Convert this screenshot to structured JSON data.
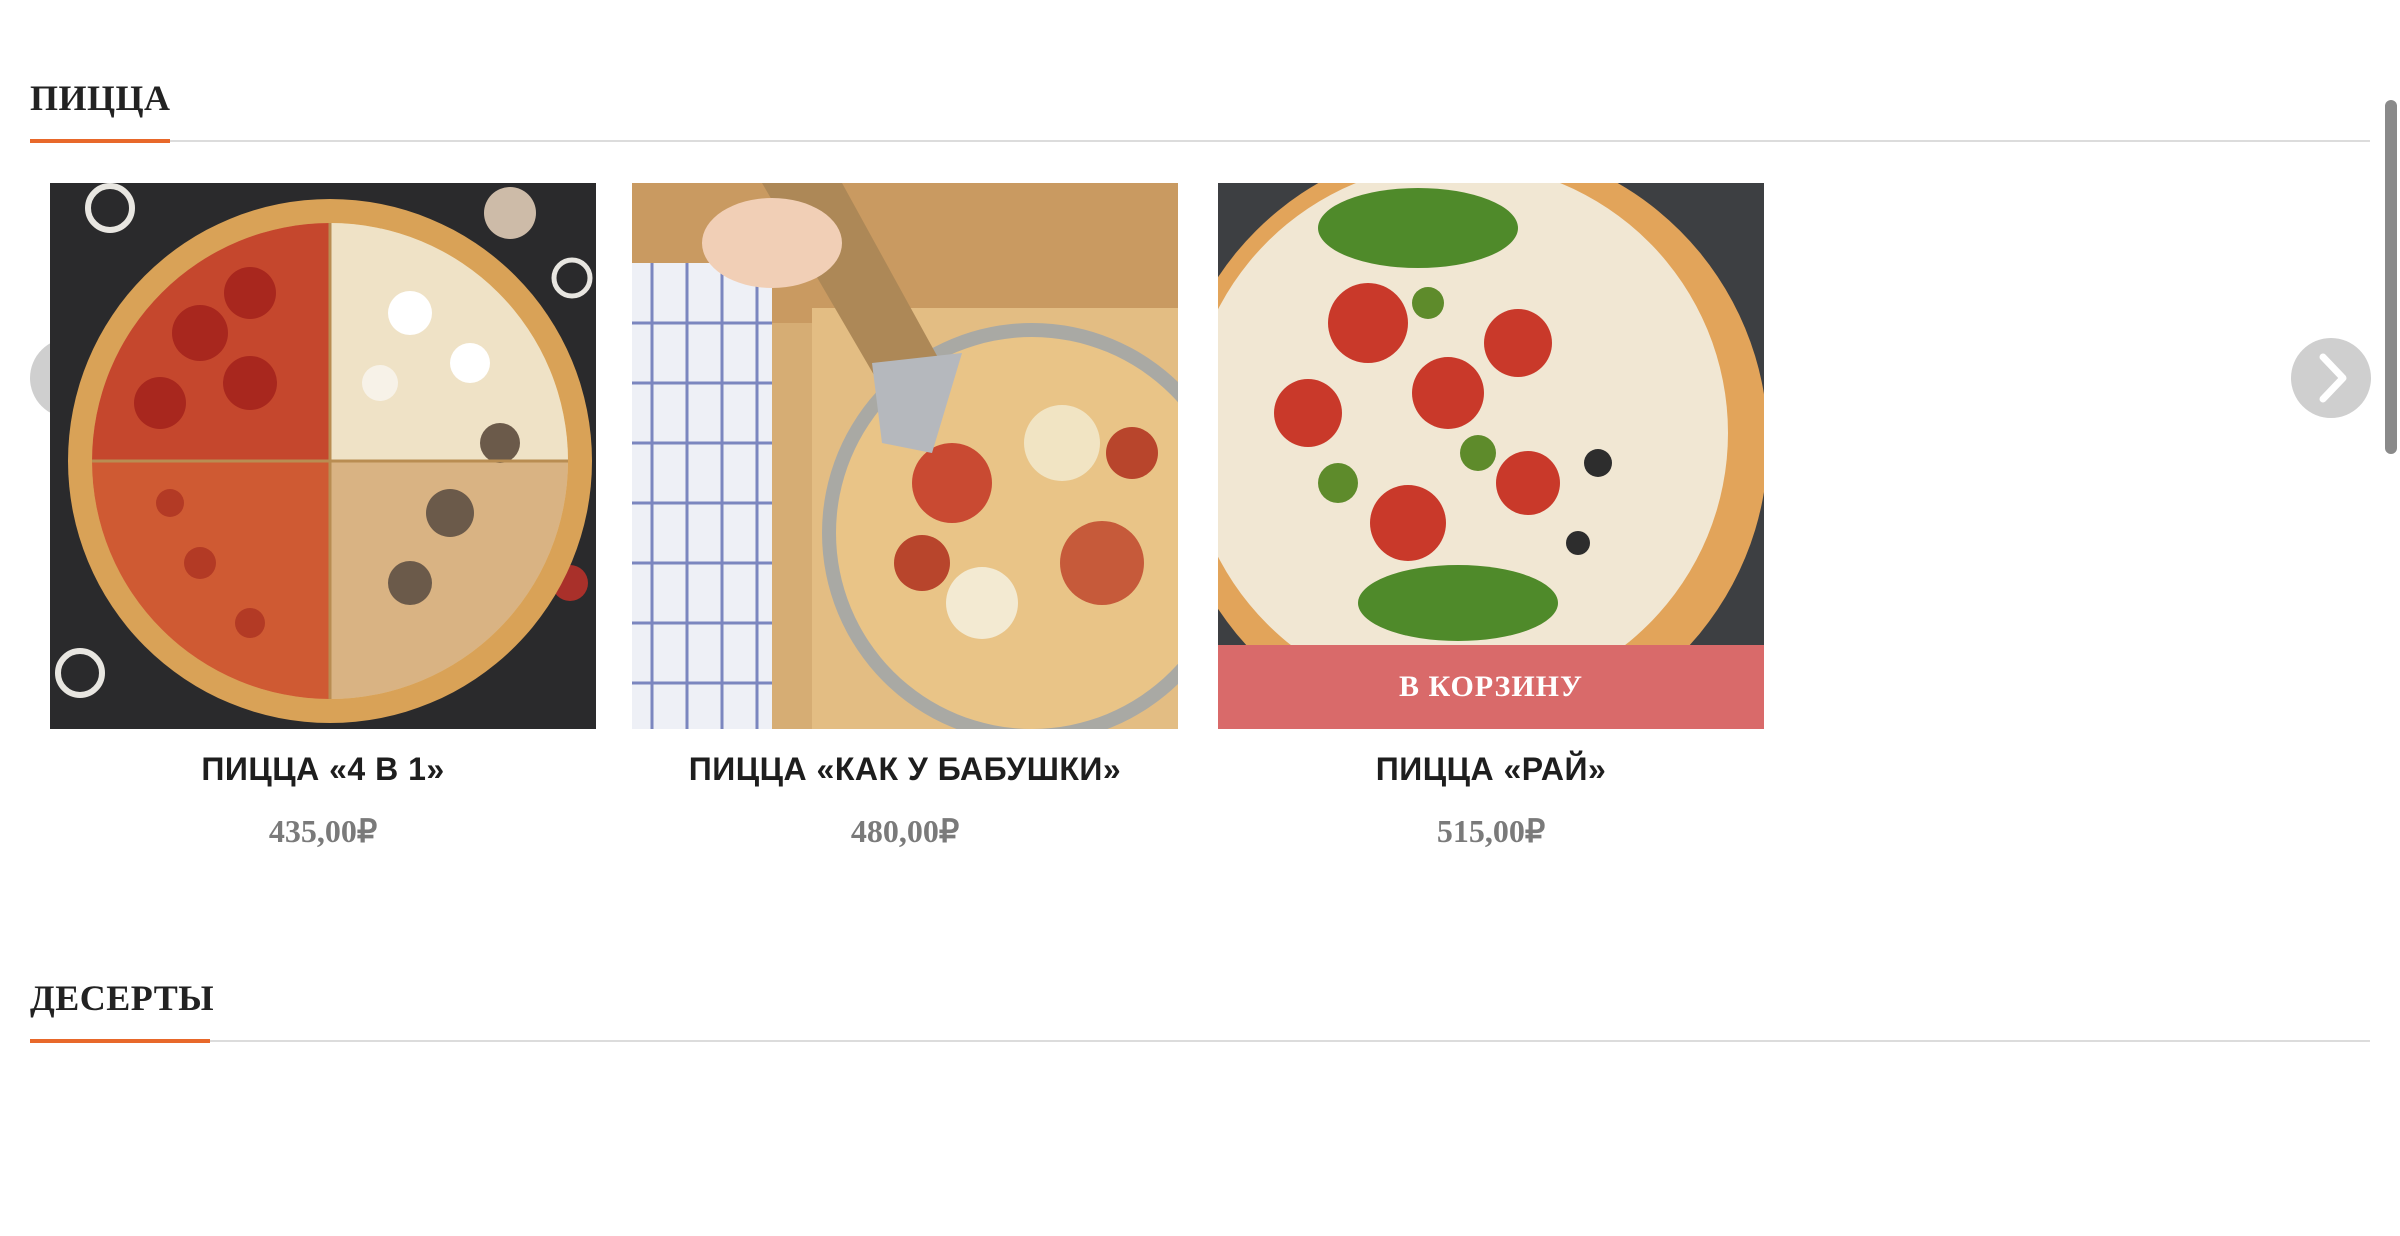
{
  "sections": [
    {
      "title": "ПИЦЦА",
      "products": [
        {
          "name": "ПИЦЦА «4 В 1»",
          "price": "435,00₽"
        },
        {
          "name": "ПИЦЦА «КАК У БАБУШКИ»",
          "price": "480,00₽"
        },
        {
          "name": "ПИЦЦА «РАЙ»",
          "price": "515,00₽",
          "add_to_cart_label": "В КОРЗИНУ"
        }
      ]
    },
    {
      "title": "ДЕСЕРТЫ"
    }
  ],
  "colors": {
    "accent": "#e8682a",
    "cart_button": "#d96a6a",
    "price_text": "#7a7a7a",
    "nav_button": "#cfcfcf"
  },
  "icons": {
    "prev": "chevron-left-icon",
    "next": "chevron-right-icon"
  }
}
